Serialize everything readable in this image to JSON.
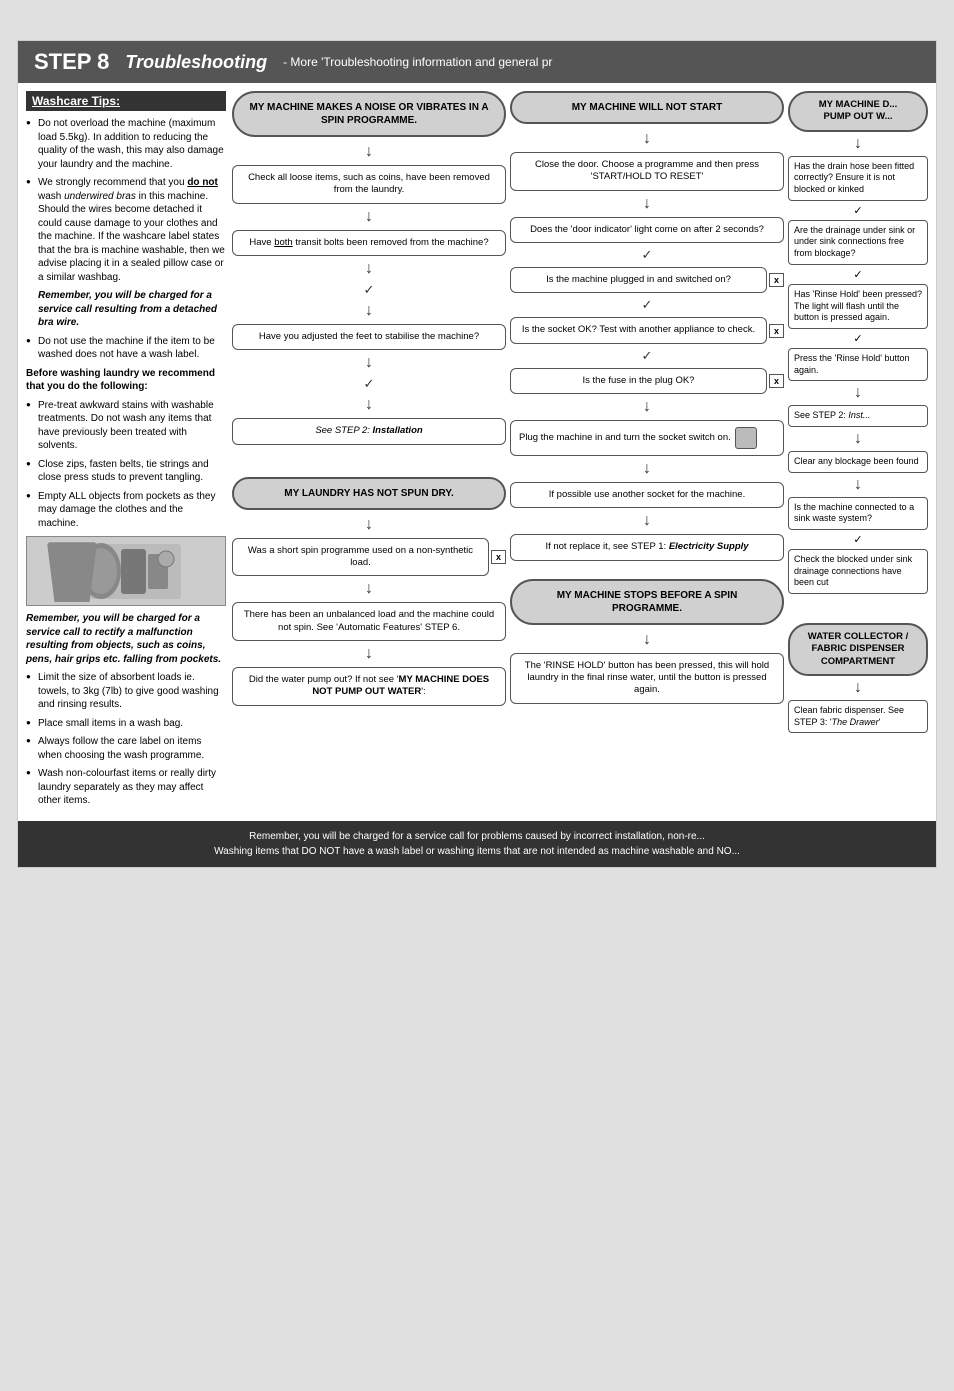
{
  "header": {
    "step_label": "STEP 8",
    "title": "Troubleshooting",
    "dash": "-",
    "subtitle": "More 'Troubleshooting information and general pr"
  },
  "washcare": {
    "heading": "Washcare Tips:",
    "tips": [
      "Do not overload the machine (maximum load 5.5kg). In addition to reducing the quality of the wash, this may also damage your laundry and the machine.",
      "We strongly recommend that you do not wash underwired bras in this machine. Should the wires become detached it could cause damage to your clothes and the machine. If the washcare label states that the bra is machine washable, then we advise placing it in a sealed pillow case or a similar washbag.",
      "Remember, you will be charged for a service call resulting from a detached bra wire.",
      "Do not use the machine if the item to be washed does not have a wash label.",
      "Before washing laundry we recommend that you do the following:",
      "Pre-treat awkward stains with washable treatments. Do not wash any items that have previously been treated with solvents.",
      "Close zips, fasten belts, tie strings and close press studs to prevent tangling.",
      "Empty ALL objects from pockets as they may damage the clothes and the machine.",
      "Remember, you will be charged for a service call to rectify a malfunction resulting from objects, such as coins, pens, hair grips etc. falling from pockets.",
      "Limit the size of absorbent loads ie. towels, to 3kg (7lb) to give good washing and rinsing results.",
      "Place small items in a wash bag.",
      "Always follow the care label on items when choosing the wash programme.",
      "Wash non-colourfast items or really dirty laundry separately as they may affect other items."
    ]
  },
  "col1": {
    "bubble": "MY MACHINE MAKES A NOISE OR VIBRATES IN A SPIN PROGRAMME.",
    "steps": [
      "Check all loose items, such as coins, have been removed from the laundry.",
      "Have both transit bolts been removed from the machine?",
      "Have you adjusted the feet to stabilise the machine?",
      "See STEP 2: Installation"
    ]
  },
  "col1b": {
    "bubble": "MY LAUNDRY HAS NOT SPUN DRY.",
    "steps": [
      "Was a short spin programme used on a non-synthetic load.",
      "There has been an unbalanced load and the machine could not spin. See 'Automatic Features' STEP 6.",
      "Did the water pump out? If not see 'MY MACHINE DOES NOT PUMP OUT WATER':"
    ]
  },
  "col2": {
    "bubble": "MY MACHINE WILL NOT START",
    "steps": [
      "Close the door. Choose a programme and then press 'START/HOLD TO RESET'",
      "Does the 'door indicator' light come on after 2 seconds?",
      "Is the machine plugged in and switched on?",
      "Is the socket OK? Test with another appliance to check.",
      "Is the fuse in the plug OK?",
      "Plug the machine in and turn the socket switch on.",
      "If possible use another socket for the machine.",
      "If not replace it, see STEP 1: Electricity Supply"
    ],
    "bubble2": "MY MACHINE STOPS BEFORE A SPIN PROGRAMME.",
    "rinse_hold": "The 'RINSE HOLD' button has been pressed, this will hold laundry in the final rinse water, until the button is pressed again."
  },
  "col3": {
    "bubble": "MY MACHINE DOES NOT PUMP OUT WATER",
    "items": [
      "Has the drain hose been fitted correctly? Ensure it is not blocked or kinked",
      "Are the drainage under sink or under sink connections free from blockage?",
      "Has 'Rinse Hold' been pressed? The light will flash until the button is pressed again.",
      "Press the 'Rinse Hold' button again.",
      "See STEP 2: Inst...",
      "Clear any blockage been found",
      "Is the machine connected to a sink waste system?",
      "Check the blocked under sink drainage connections have been cut",
      "WATER COLLECTOR / FABRIC DISPENSER COMPARTMENT",
      "Clean fabric dispenser. See STEP 3: 'The Drawer'"
    ]
  },
  "footer": {
    "line1": "Remember, you will be charged for a service call for problems caused by incorrect installation, non-re...",
    "line2": "Washing items that DO NOT have a wash label or washing items that are not intended as machine washable and NO..."
  }
}
